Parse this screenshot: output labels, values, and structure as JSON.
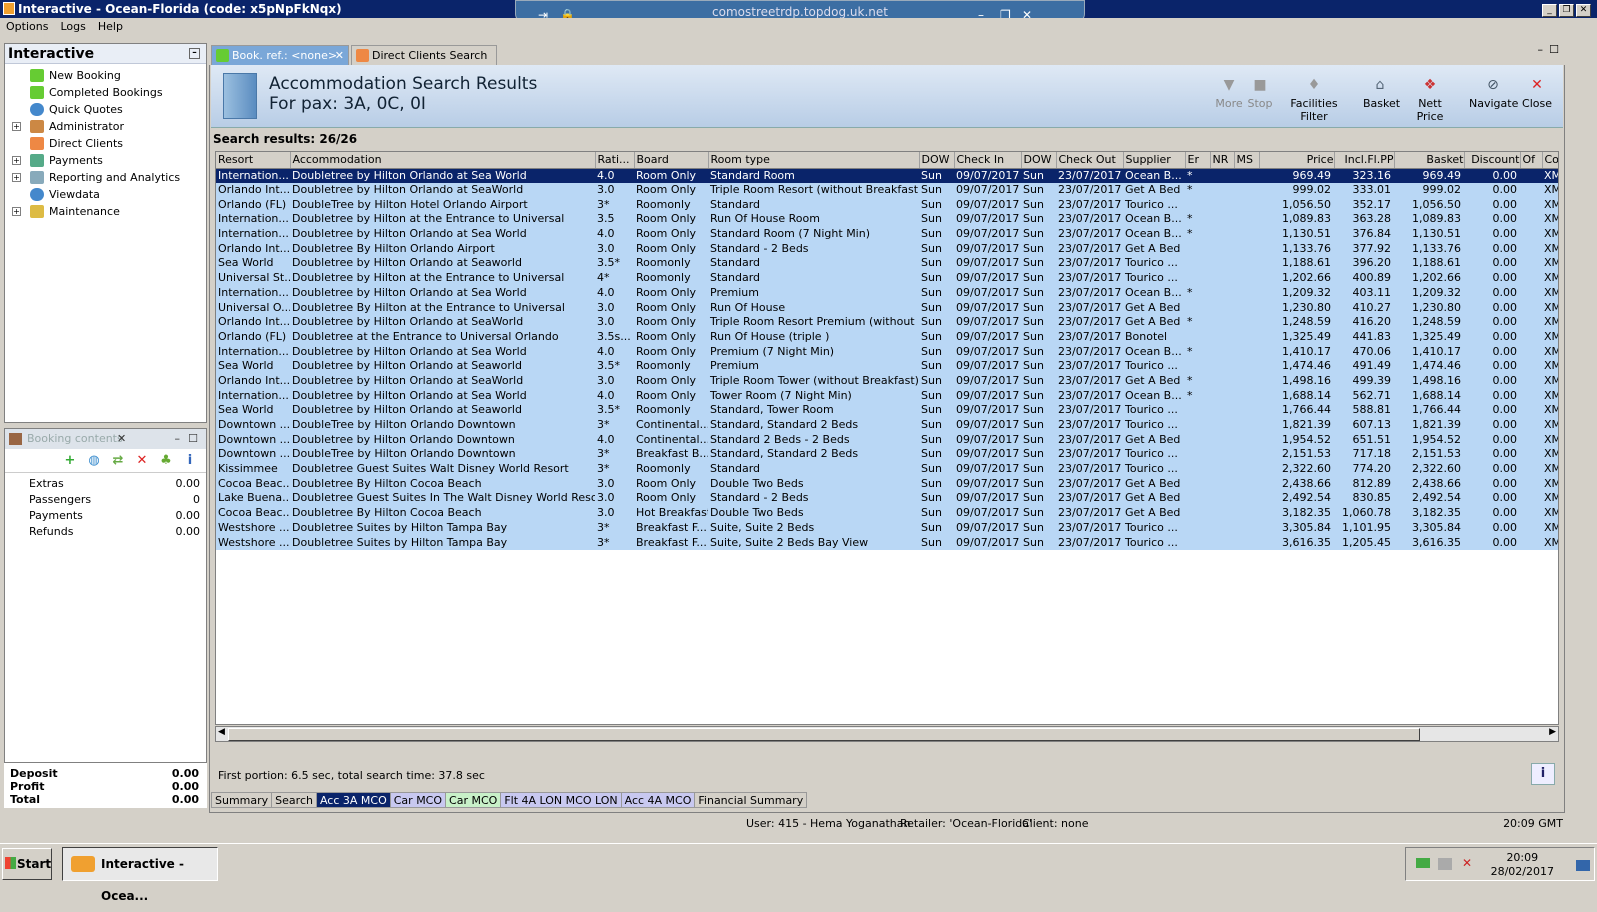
{
  "window": {
    "title": "Interactive - Ocean-Florida (code: x5pNpFkNqx)",
    "rdp_host": "comostreetrdp.topdog.uk.net"
  },
  "menu": [
    "Options",
    "Logs",
    "Help"
  ],
  "left_panel": {
    "title": "Interactive",
    "items": [
      {
        "label": "New Booking",
        "expandable": false
      },
      {
        "label": "Completed Bookings",
        "expandable": false
      },
      {
        "label": "Quick Quotes",
        "expandable": false
      },
      {
        "label": "Administrator",
        "expandable": true
      },
      {
        "label": "Direct Clients",
        "expandable": false
      },
      {
        "label": "Payments",
        "expandable": true
      },
      {
        "label": "Reporting and Analytics",
        "expandable": true
      },
      {
        "label": "Viewdata",
        "expandable": false
      },
      {
        "label": "Maintenance",
        "expandable": true
      }
    ]
  },
  "booking_contents": {
    "title": "Booking contents",
    "rows": [
      {
        "label": "Extras",
        "value": "0.00"
      },
      {
        "label": "Passengers",
        "value": "0"
      },
      {
        "label": "Payments",
        "value": "0.00"
      },
      {
        "label": "Refunds",
        "value": "0.00"
      }
    ],
    "totals": [
      {
        "label": "Deposit",
        "value": "0.00"
      },
      {
        "label": "Profit",
        "value": "0.00"
      },
      {
        "label": "Total",
        "value": "0.00"
      }
    ]
  },
  "tabs": [
    {
      "label": "Book. ref.: <none>",
      "active": true,
      "closable": true
    },
    {
      "label": "Direct Clients Search",
      "active": false,
      "closable": false
    }
  ],
  "header": {
    "title": "Accommodation Search Results",
    "subtitle": "For pax: 3A, 0C, 0I",
    "toolbar": [
      {
        "label": "More",
        "icon": "chevron-down-icon",
        "enabled": false
      },
      {
        "label": "Stop",
        "icon": "stop-icon",
        "enabled": false
      },
      {
        "label": "Facilities Filter",
        "icon": "filter-icon",
        "enabled": true
      },
      {
        "label": "Basket",
        "icon": "basket-icon",
        "enabled": true
      },
      {
        "label": "Nett Price",
        "icon": "price-icon",
        "enabled": true
      },
      {
        "label": "Navigate",
        "icon": "navigate-icon",
        "enabled": true
      },
      {
        "label": "Close",
        "icon": "close-icon",
        "enabled": true
      }
    ]
  },
  "results_label": "Search results: 26/26",
  "columns": [
    "Resort",
    "Accommodation",
    "Rati...",
    "Board",
    "Room type",
    "DOW",
    "Check In",
    "DOW",
    "Check Out",
    "Supplier",
    "Er",
    "NR",
    "MS",
    "Price",
    "Incl.Fl.PP",
    "Basket",
    "Discount",
    "Of",
    "Contract"
  ],
  "rows": [
    [
      "Internation...",
      "Doubletree by Hilton Orlando at Sea World",
      "4.0",
      "Room Only",
      "Standard Room",
      "Sun",
      "09/07/2017",
      "Sun",
      "23/07/2017",
      "Ocean B...",
      "*",
      "",
      "",
      "969.49",
      "323.16",
      "969.49",
      "0.00",
      "",
      "XML"
    ],
    [
      "Orlando Int...",
      "Doubletree by Hilton Orlando at SeaWorld",
      "3.0",
      "Room Only",
      "Triple Room Resort (without Breakfast)",
      "Sun",
      "09/07/2017",
      "Sun",
      "23/07/2017",
      "Get A Bed",
      "*",
      "",
      "",
      "999.02",
      "333.01",
      "999.02",
      "0.00",
      "",
      "XML"
    ],
    [
      "Orlando (FL)",
      "DoubleTree by Hilton Hotel Orlando Airport",
      "3*",
      "Roomonly",
      "Standard",
      "Sun",
      "09/07/2017",
      "Sun",
      "23/07/2017",
      "Tourico ...",
      "",
      "",
      "",
      "1,056.50",
      "352.17",
      "1,056.50",
      "0.00",
      "",
      "XML"
    ],
    [
      "Internation...",
      "Doubletree by Hilton at the Entrance to Universal",
      "3.5",
      "Room Only",
      "Run Of House Room",
      "Sun",
      "09/07/2017",
      "Sun",
      "23/07/2017",
      "Ocean B...",
      "*",
      "",
      "",
      "1,089.83",
      "363.28",
      "1,089.83",
      "0.00",
      "",
      "XML"
    ],
    [
      "Internation...",
      "Doubletree by Hilton Orlando at Sea World",
      "4.0",
      "Room Only",
      "Standard Room (7 Night Min)",
      "Sun",
      "09/07/2017",
      "Sun",
      "23/07/2017",
      "Ocean B...",
      "*",
      "",
      "",
      "1,130.51",
      "376.84",
      "1,130.51",
      "0.00",
      "",
      "XML"
    ],
    [
      "Orlando Int...",
      "Doubletree By Hilton Orlando Airport",
      "3.0",
      "Room Only",
      "Standard - 2 Beds",
      "Sun",
      "09/07/2017",
      "Sun",
      "23/07/2017",
      "Get A Bed",
      "",
      "",
      "",
      "1,133.76",
      "377.92",
      "1,133.76",
      "0.00",
      "",
      "XML"
    ],
    [
      "Sea World",
      "Doubletree by Hilton Orlando at Seaworld",
      "3.5*",
      "Roomonly",
      "Standard",
      "Sun",
      "09/07/2017",
      "Sun",
      "23/07/2017",
      "Tourico ...",
      "",
      "",
      "",
      "1,188.61",
      "396.20",
      "1,188.61",
      "0.00",
      "",
      "XML"
    ],
    [
      "Universal St...",
      "Doubletree by Hilton at the Entrance to Universal",
      "4*",
      "Roomonly",
      "Standard",
      "Sun",
      "09/07/2017",
      "Sun",
      "23/07/2017",
      "Tourico ...",
      "",
      "",
      "",
      "1,202.66",
      "400.89",
      "1,202.66",
      "0.00",
      "",
      "XML"
    ],
    [
      "Internation...",
      "Doubletree by Hilton Orlando at Sea World",
      "4.0",
      "Room Only",
      "Premium",
      "Sun",
      "09/07/2017",
      "Sun",
      "23/07/2017",
      "Ocean B...",
      "*",
      "",
      "",
      "1,209.32",
      "403.11",
      "1,209.32",
      "0.00",
      "",
      "XML"
    ],
    [
      "Universal O...",
      "Doubletree By Hilton at the Entrance to Universal",
      "3.0",
      "Room Only",
      "Run  Of House",
      "Sun",
      "09/07/2017",
      "Sun",
      "23/07/2017",
      "Get A Bed",
      "",
      "",
      "",
      "1,230.80",
      "410.27",
      "1,230.80",
      "0.00",
      "",
      "XML"
    ],
    [
      "Orlando Int...",
      "Doubletree by Hilton Orlando at SeaWorld",
      "3.0",
      "Room Only",
      "Triple Room Resort Premium (without Bre...",
      "Sun",
      "09/07/2017",
      "Sun",
      "23/07/2017",
      "Get A Bed",
      "*",
      "",
      "",
      "1,248.59",
      "416.20",
      "1,248.59",
      "0.00",
      "",
      "XML"
    ],
    [
      "Orlando (FL)",
      "Doubletree at the Entrance to Universal Orlando",
      "3.5s...",
      "Room Only",
      "Run Of House (triple )",
      "Sun",
      "09/07/2017",
      "Sun",
      "23/07/2017",
      "Bonotel",
      "",
      "",
      "",
      "1,325.49",
      "441.83",
      "1,325.49",
      "0.00",
      "",
      "XML"
    ],
    [
      "Internation...",
      "Doubletree by Hilton Orlando at Sea World",
      "4.0",
      "Room Only",
      "Premium (7 Night Min)",
      "Sun",
      "09/07/2017",
      "Sun",
      "23/07/2017",
      "Ocean B...",
      "*",
      "",
      "",
      "1,410.17",
      "470.06",
      "1,410.17",
      "0.00",
      "",
      "XML"
    ],
    [
      "Sea World",
      "Doubletree by Hilton Orlando at Seaworld",
      "3.5*",
      "Roomonly",
      "Premium",
      "Sun",
      "09/07/2017",
      "Sun",
      "23/07/2017",
      "Tourico ...",
      "",
      "",
      "",
      "1,474.46",
      "491.49",
      "1,474.46",
      "0.00",
      "",
      "XML"
    ],
    [
      "Orlando Int...",
      "Doubletree by Hilton Orlando at SeaWorld",
      "3.0",
      "Room Only",
      "Triple Room Tower (without Breakfast)",
      "Sun",
      "09/07/2017",
      "Sun",
      "23/07/2017",
      "Get A Bed",
      "*",
      "",
      "",
      "1,498.16",
      "499.39",
      "1,498.16",
      "0.00",
      "",
      "XML"
    ],
    [
      "Internation...",
      "Doubletree by Hilton Orlando at Sea World",
      "4.0",
      "Room Only",
      "Tower Room (7 Night Min)",
      "Sun",
      "09/07/2017",
      "Sun",
      "23/07/2017",
      "Ocean B...",
      "*",
      "",
      "",
      "1,688.14",
      "562.71",
      "1,688.14",
      "0.00",
      "",
      "XML"
    ],
    [
      "Sea World",
      "Doubletree by Hilton Orlando at Seaworld",
      "3.5*",
      "Roomonly",
      "Standard, Tower Room",
      "Sun",
      "09/07/2017",
      "Sun",
      "23/07/2017",
      "Tourico ...",
      "",
      "",
      "",
      "1,766.44",
      "588.81",
      "1,766.44",
      "0.00",
      "",
      "XML"
    ],
    [
      "Downtown ...",
      "DoubleTree by Hilton Orlando Downtown",
      "3*",
      "Continental...",
      "Standard, Standard 2 Beds",
      "Sun",
      "09/07/2017",
      "Sun",
      "23/07/2017",
      "Tourico ...",
      "",
      "",
      "",
      "1,821.39",
      "607.13",
      "1,821.39",
      "0.00",
      "",
      "XML"
    ],
    [
      "Downtown ...",
      "Doubletree by Hilton Orlando Downtown",
      "4.0",
      "Continental...",
      "Standard 2 Beds - 2 Beds",
      "Sun",
      "09/07/2017",
      "Sun",
      "23/07/2017",
      "Get A Bed",
      "",
      "",
      "",
      "1,954.52",
      "651.51",
      "1,954.52",
      "0.00",
      "",
      "XML"
    ],
    [
      "Downtown ...",
      "DoubleTree by Hilton Orlando Downtown",
      "3*",
      "Breakfast B...",
      "Standard, Standard 2 Beds",
      "Sun",
      "09/07/2017",
      "Sun",
      "23/07/2017",
      "Tourico ...",
      "",
      "",
      "",
      "2,151.53",
      "717.18",
      "2,151.53",
      "0.00",
      "",
      "XML"
    ],
    [
      "Kissimmee",
      "Doubletree Guest Suites Walt Disney World Resort",
      "3*",
      "Roomonly",
      "Standard",
      "Sun",
      "09/07/2017",
      "Sun",
      "23/07/2017",
      "Tourico ...",
      "",
      "",
      "",
      "2,322.60",
      "774.20",
      "2,322.60",
      "0.00",
      "",
      "XML"
    ],
    [
      "Cocoa Beac...",
      "Doubletree By Hilton Cocoa Beach",
      "3.0",
      "Room Only",
      "Double Two Beds",
      "Sun",
      "09/07/2017",
      "Sun",
      "23/07/2017",
      "Get A Bed",
      "",
      "",
      "",
      "2,438.66",
      "812.89",
      "2,438.66",
      "0.00",
      "",
      "XML"
    ],
    [
      "Lake Buena...",
      "Doubletree Guest Suites In The Walt Disney World Resort",
      "3.0",
      "Room Only",
      "Standard - 2 Beds",
      "Sun",
      "09/07/2017",
      "Sun",
      "23/07/2017",
      "Get A Bed",
      "",
      "",
      "",
      "2,492.54",
      "830.85",
      "2,492.54",
      "0.00",
      "",
      "XML"
    ],
    [
      "Cocoa Beac...",
      "Doubletree By Hilton Cocoa Beach",
      "3.0",
      "Hot Breakfast",
      "Double Two Beds",
      "Sun",
      "09/07/2017",
      "Sun",
      "23/07/2017",
      "Get A Bed",
      "",
      "",
      "",
      "3,182.35",
      "1,060.78",
      "3,182.35",
      "0.00",
      "",
      "XML"
    ],
    [
      "Westshore ...",
      "Doubletree Suites by Hilton Tampa Bay",
      "3*",
      "Breakfast F...",
      "Suite, Suite 2 Beds",
      "Sun",
      "09/07/2017",
      "Sun",
      "23/07/2017",
      "Tourico ...",
      "",
      "",
      "",
      "3,305.84",
      "1,101.95",
      "3,305.84",
      "0.00",
      "",
      "XML"
    ],
    [
      "Westshore ...",
      "Doubletree Suites by Hilton Tampa Bay",
      "3*",
      "Breakfast F...",
      "Suite, Suite 2 Beds Bay View",
      "Sun",
      "09/07/2017",
      "Sun",
      "23/07/2017",
      "Tourico ...",
      "",
      "",
      "",
      "3,616.35",
      "1,205.45",
      "3,616.35",
      "0.00",
      "",
      "XML"
    ]
  ],
  "status_text": "First portion: 6.5 sec, total search time: 37.8 sec",
  "bottom_tabs": [
    {
      "label": "Summary",
      "color": "#d4d0c8",
      "text": "#000000"
    },
    {
      "label": "Search",
      "color": "#d4d0c8",
      "text": "#000000"
    },
    {
      "label": "Acc 3A MCO",
      "color": "#0a246a",
      "text": "#ffffff"
    },
    {
      "label": "Car MCO",
      "color": "#c8c8f0",
      "text": "#000000"
    },
    {
      "label": "Car MCO",
      "color": "#c8f0c8",
      "text": "#000000"
    },
    {
      "label": "Flt 4A LON MCO LON",
      "color": "#c8c8f0",
      "text": "#000000"
    },
    {
      "label": "Acc 4A MCO",
      "color": "#c8c8f0",
      "text": "#000000"
    },
    {
      "label": "Financial Summary",
      "color": "#d4d0c8",
      "text": "#000000"
    }
  ],
  "app_status": {
    "user": "User: 415 - Hema Yoganathan",
    "retailer": "Retailer: 'Ocean-Florida'",
    "client": "Client: none",
    "time": "20:09 GMT"
  },
  "taskbar": {
    "start": "Start",
    "app": "Interactive - Ocea...",
    "clock_time": "20:09",
    "clock_date": "28/02/2017"
  }
}
